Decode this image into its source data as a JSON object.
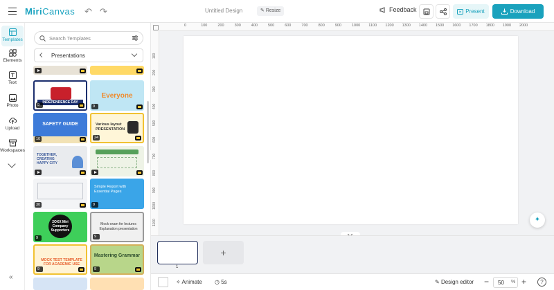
{
  "app": {
    "logo_text": "Miri",
    "logo_text2": "Canvas",
    "document_title": "Untitled Design",
    "resize_label": "Resize",
    "feedback_label": "Feedback",
    "present_label": "Present",
    "download_label": "Download",
    "brand_color": "#1aa2bd"
  },
  "rail": {
    "items": [
      {
        "label": "Templates",
        "icon": "templates-icon"
      },
      {
        "label": "Elements",
        "icon": "elements-icon"
      },
      {
        "label": "Text",
        "icon": "text-icon"
      },
      {
        "label": "Photo",
        "icon": "photo-icon"
      },
      {
        "label": "Upload",
        "icon": "upload-icon"
      },
      {
        "label": "Workspaces",
        "icon": "workspaces-icon"
      }
    ],
    "collapse_label": "«"
  },
  "panel": {
    "search_placeholder": "Search Templates",
    "category": "Presentations",
    "templates": [
      {
        "title": "",
        "count": "",
        "bg": "#e8e2d6",
        "accent": "#222"
      },
      {
        "title": "",
        "count": "",
        "bg": "#ffd966",
        "accent": "#29a4d9"
      },
      {
        "title": "INDEPENDENCE DAY",
        "count": "9",
        "bg": "#ffffff",
        "accent": "#1c2f6e"
      },
      {
        "title": "Everyone",
        "count": "9",
        "bg": "#bfe6f4",
        "accent": "#f08a2b"
      },
      {
        "title": "SAFETY GUIDE",
        "count": "10",
        "bg": "#3d7bd9",
        "accent": "#ffffff"
      },
      {
        "title": "Various layout PRESENTATION",
        "count": "24",
        "bg": "#fff6d8",
        "accent": "#e6a400"
      },
      {
        "title": "TOGETHER, CREATING HAPPY CITY",
        "count": "",
        "bg": "#e9ebee",
        "accent": "#3c5a9a"
      },
      {
        "title": "",
        "count": "",
        "bg": "#eef3e6",
        "accent": "#56a05a"
      },
      {
        "title": "",
        "count": "30",
        "bg": "#f3f4f6",
        "accent": "#9aa3b0"
      },
      {
        "title": "Simple Report with Essential Pages",
        "count": "9",
        "bg": "#3aa5e8",
        "accent": "#ffffff"
      },
      {
        "title": "2OXX Miri Company Supporters",
        "count": "9",
        "bg": "#3ecf5a",
        "accent": "#111111"
      },
      {
        "title": "Mock exam for lectures Explanation presentation",
        "count": "9",
        "bg": "#f0f0f0",
        "accent": "#333333"
      },
      {
        "title": "MOCK TEST TEMPLATE FOR ACADEMIC USE",
        "count": "9",
        "bg": "#fff3d6",
        "accent": "#e65c2b"
      },
      {
        "title": "Mastering Grammar",
        "count": "9",
        "bg": "#b8d68a",
        "accent": "#2f4f2f"
      },
      {
        "title": "",
        "count": "",
        "bg": "#d6e4f5",
        "accent": "#555"
      },
      {
        "title": "",
        "count": "",
        "bg": "#ffe0b3",
        "accent": "#555"
      }
    ]
  },
  "ruler": {
    "top_ticks": [
      "0",
      "100",
      "200",
      "300",
      "400",
      "500",
      "600",
      "700",
      "800",
      "900",
      "1000",
      "1100",
      "1200",
      "1300",
      "1400",
      "1500",
      "1600",
      "1700",
      "1800",
      "1900",
      "2000"
    ],
    "left_ticks": [
      "100",
      "200",
      "300",
      "400",
      "500",
      "600",
      "700",
      "800",
      "900",
      "1000",
      "1100"
    ]
  },
  "pages": {
    "current_page_number": "1",
    "add_label": "+"
  },
  "bottom": {
    "animate_label": "Animate",
    "duration_label": "5s",
    "design_editor_label": "Design editor",
    "zoom_value": "50",
    "zoom_unit": "%",
    "zoom_minus": "−",
    "zoom_plus": "+",
    "help_label": "?"
  }
}
